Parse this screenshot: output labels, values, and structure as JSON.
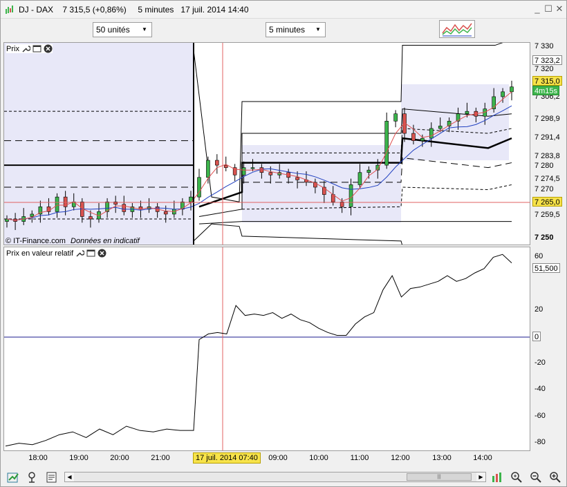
{
  "window": {
    "title": "DJ - DAX    7 315,5 (+0,86%)     5 minutes   17 juil. 2014 14:40",
    "minimize": "_",
    "maximize": "☐",
    "close": "✕"
  },
  "toolbar": {
    "units_select": "50 unités",
    "interval_select": "5 minutes",
    "indicator_button_icon": "indicators-chart-icon"
  },
  "price_panel": {
    "label": "Prix",
    "watermark_source": "© IT-Finance.com",
    "watermark_note": "Données en indicatif"
  },
  "indicator_panel": {
    "label": "Prix en valeur relatif"
  },
  "price_axis": {
    "ticks": [
      "7 330",
      "7 320",
      "7 306,2",
      "7 298,9",
      "7 291,4",
      "7 283,8",
      "7 280",
      "7 274,5",
      "7 270",
      "7 259,5",
      "7 250"
    ],
    "badges": {
      "high": "7 323,2",
      "last": "7 315,0",
      "countdown": "4m15s",
      "cursor": "7 265,0"
    }
  },
  "indicator_axis": {
    "ticks": [
      "60",
      "20",
      "-20",
      "-40",
      "-60",
      "-80"
    ],
    "badges": {
      "last": "51,500",
      "zero": "0"
    }
  },
  "time_axis": {
    "ticks": [
      "18:00",
      "19:00",
      "20:00",
      "21:00",
      "09:00",
      "10:00",
      "11:00",
      "12:00",
      "13:00",
      "14:00"
    ],
    "cursor_label": "17 juil. 2014 07:40"
  },
  "colors": {
    "up_candle": "#3cb44b",
    "down_candle": "#d9534f",
    "ma_fast": "#e05050",
    "ma_slow": "#2040c0",
    "band_fill": "#e8e8f8",
    "cursor": "#e06060",
    "zero_line": "#1a1a8c"
  },
  "chart_data": [
    {
      "type": "line",
      "title": "",
      "ylim": [
        7250,
        7333
      ],
      "series": [
        {
          "values": [
            7261,
            7260,
            7262,
            7263,
            7266,
            7264,
            7270,
            7266,
            7268,
            7262,
            7261,
            7264,
            7268,
            7267,
            7264,
            7266,
            7265,
            7266,
            7264,
            7263,
            7265,
            7268,
            7270,
            7278,
            7285,
            7283,
            7282,
            7279,
            7282,
            7282,
            7280,
            7279,
            7280,
            7278,
            7277,
            7276,
            7274,
            7271,
            7268,
            7266,
            7275,
            7280,
            7281,
            7283,
            7301,
            7304,
            7296,
            7293,
            7294,
            7298,
            7299,
            7301,
            7304,
            7305,
            7303,
            7306,
            7311,
            7313,
            7315
          ]
        }
      ]
    },
    {
      "type": "line",
      "title": "",
      "ylim": [
        -82,
        62
      ],
      "series": [
        {
          "values": [
            -78,
            -76,
            -77,
            -74,
            -70,
            -68,
            -72,
            -66,
            -70,
            -64,
            -67,
            -68,
            -66,
            -67,
            -67,
            -3,
            1,
            2,
            1,
            21,
            14,
            15,
            14,
            16,
            12,
            15,
            11,
            9,
            5,
            2,
            0,
            0,
            8,
            13,
            16,
            32,
            42,
            27,
            33,
            34,
            36,
            38,
            42,
            38,
            40,
            44,
            47,
            55,
            57,
            51
          ]
        }
      ]
    }
  ]
}
